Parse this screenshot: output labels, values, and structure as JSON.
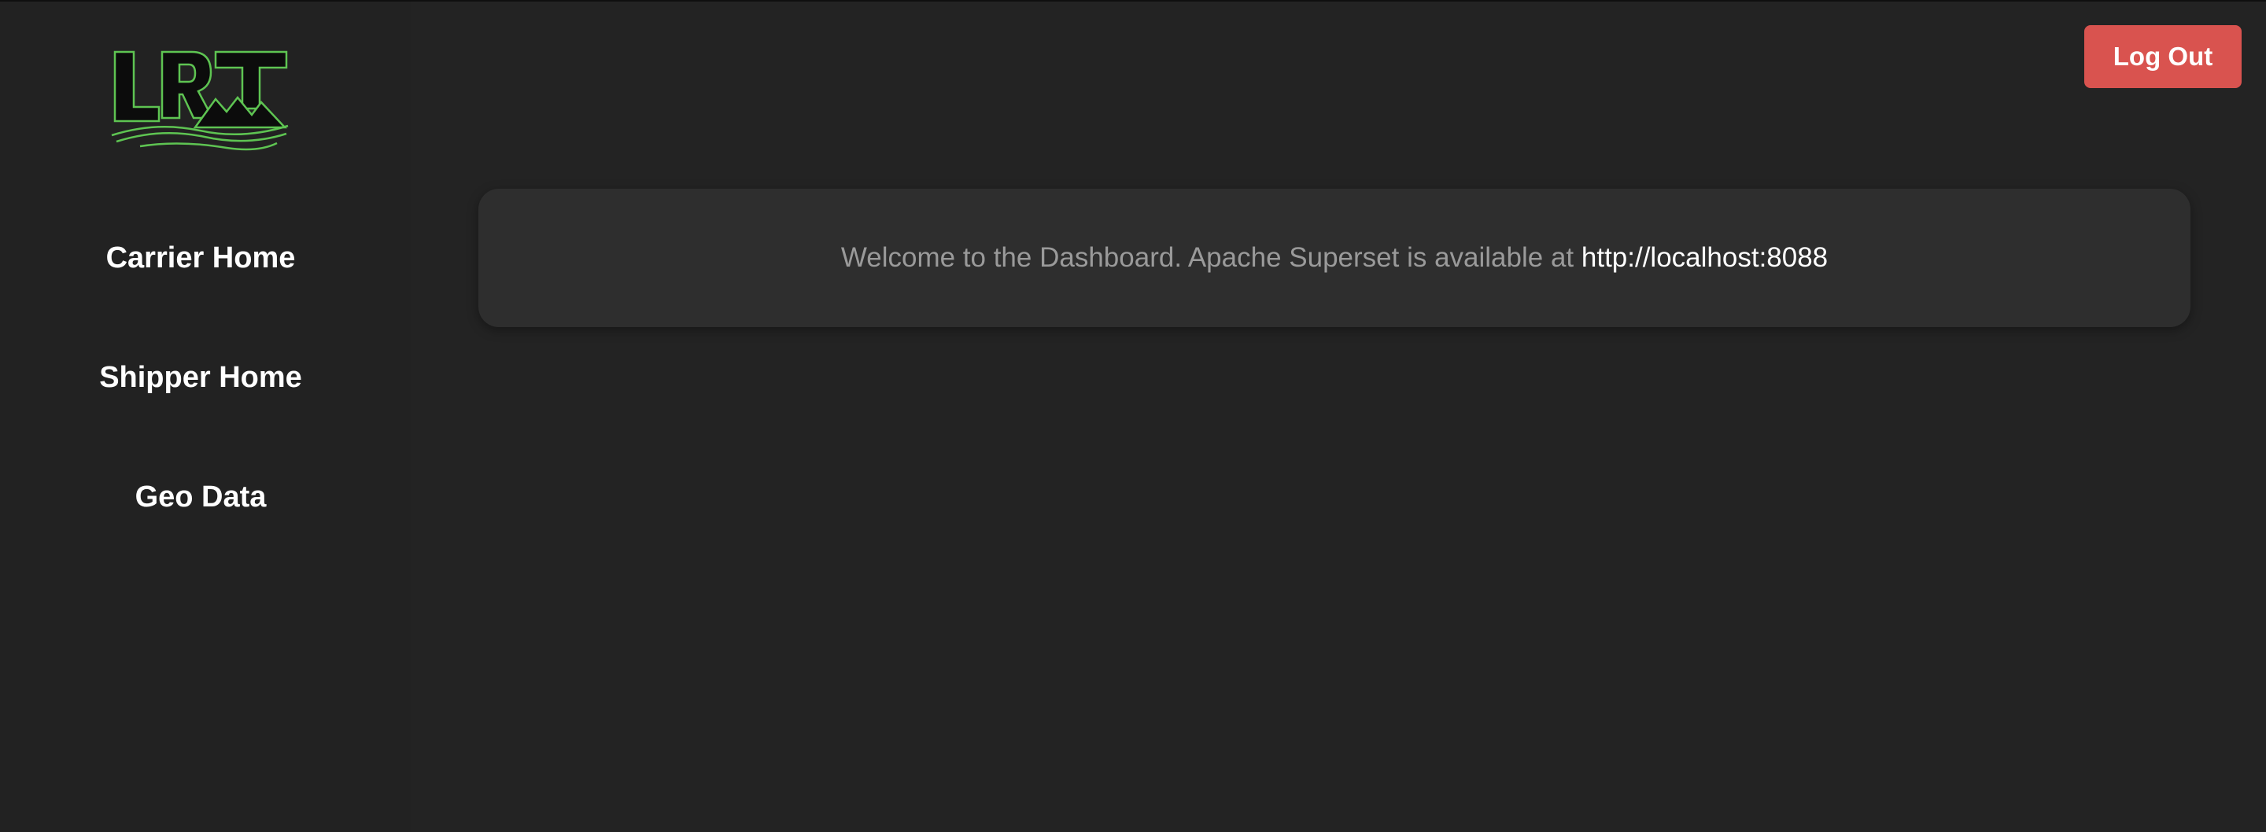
{
  "sidebar": {
    "logo_text": "LRT",
    "items": [
      {
        "label": "Carrier Home"
      },
      {
        "label": "Shipper Home"
      },
      {
        "label": "Geo Data"
      }
    ]
  },
  "header": {
    "logout_label": "Log Out"
  },
  "main": {
    "welcome_text": "Welcome to the Dashboard. Apache Superset is available at ",
    "welcome_link": "http://localhost:8088"
  },
  "colors": {
    "background": "#232323",
    "card": "#2e2e2e",
    "logout_button": "#d9534f",
    "logo_accent": "#5ec452",
    "muted_text": "#9a9a9a"
  }
}
